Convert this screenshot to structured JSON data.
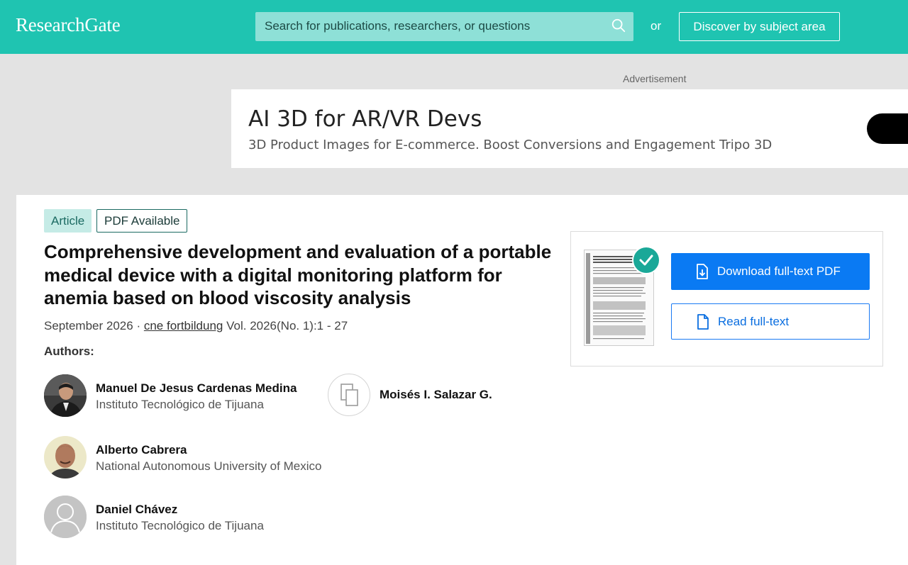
{
  "header": {
    "logo": "ResearchGate",
    "search_placeholder": "Search for publications, researchers, or questions",
    "or_label": "or",
    "discover_label": "Discover by subject area"
  },
  "ad": {
    "label": "Advertisement",
    "title": "AI 3D for AR/VR Devs",
    "subtitle": "3D Product Images for E-commerce. Boost Conversions and Engagement Tripo 3D"
  },
  "article": {
    "badges": [
      "Article",
      "PDF Available"
    ],
    "title_lines": [
      "Comprehensive development and evaluation of a portable",
      "medical device with a digital monitoring platform for",
      "anemia based on blood viscosity analysis"
    ],
    "date": "September 2026",
    "separator": "·",
    "journal": "cne fortbildung",
    "volume": "Vol. 2026(No. 1):1 - 27",
    "authors_label": "Authors:",
    "authors": [
      {
        "name": "Manuel De Jesus Cardenas Medina",
        "affiliation": "Instituto Tecnológico de Tijuana"
      },
      {
        "name": "Moisés I. Salazar G.",
        "affiliation": ""
      },
      {
        "name": "Alberto Cabrera",
        "affiliation": "National Autonomous University of Mexico"
      },
      {
        "name": "Daniel Chávez",
        "affiliation": "Instituto Tecnológico de Tijuana"
      }
    ]
  },
  "pdf_box": {
    "download_label": "Download full-text PDF",
    "read_label": "Read full-text"
  },
  "colors": {
    "brand": "#1fc4b1",
    "primary_button": "#0a7af3"
  }
}
